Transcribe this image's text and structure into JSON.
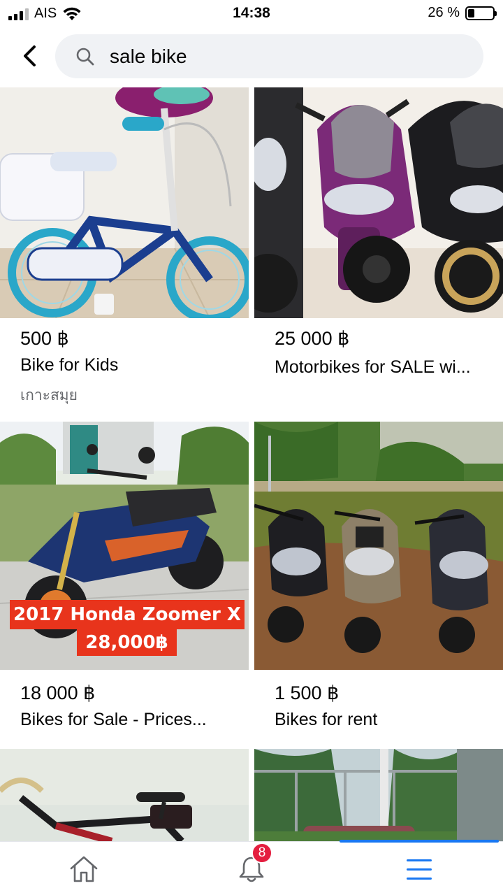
{
  "status_bar": {
    "carrier": "AIS",
    "time": "14:38",
    "battery": "26 %",
    "battery_level": 0.26
  },
  "header": {
    "back_icon": "chevron-left-icon",
    "search_icon": "search-icon",
    "search_value": "sale bike"
  },
  "listings": [
    {
      "price": "500 ฿",
      "title": "Bike for Kids",
      "location": "เกาะสมุย",
      "image": "kids-bicycle-photo"
    },
    {
      "price": "25 000 ฿",
      "title": "Motorbikes for SALE wi...",
      "location": "",
      "image": "scooters-in-showroom-photo"
    },
    {
      "price": "18 000 ฿",
      "title": "Bikes for Sale - Prices...",
      "location": "",
      "image": "honda-zoomer-photo",
      "overlay_line1": "2017 Honda Zoomer X",
      "overlay_line2": "28,000฿"
    },
    {
      "price": "1 500 ฿",
      "title": "Bikes for rent",
      "location": "",
      "image": "scooters-on-grass-photo"
    },
    {
      "price": "",
      "title": "",
      "location": "",
      "image": "road-bicycle-photo"
    },
    {
      "price": "",
      "title": "",
      "location": "",
      "image": "garden-fence-photo"
    }
  ],
  "bottom_nav": {
    "home_icon": "home-icon",
    "notifications_icon": "bell-icon",
    "notifications_count": "8",
    "menu_icon": "menu-icon"
  },
  "colors": {
    "accent": "#1877f2",
    "badge": "#e41e3f",
    "search_bg": "#f0f2f5",
    "secondary_text": "#65676b"
  }
}
